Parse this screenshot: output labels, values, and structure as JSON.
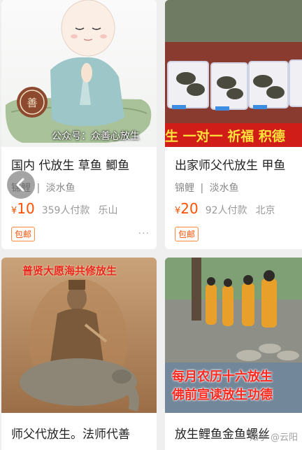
{
  "cards": [
    {
      "image_watermark": "公众号：众善心放生",
      "title": "国内 代放生 草鱼 鲫鱼",
      "tag1": "锦鲤",
      "sep": "|",
      "tag2": "淡水鱼",
      "currency": "¥",
      "price": "10",
      "sold": "359人付款",
      "location": "乐山",
      "badge": "包邮",
      "more": "···"
    },
    {
      "image_banner": "生 一对一 祈福 积德",
      "title": "出家师父代放生 甲鱼",
      "tag1": "锦鲤",
      "sep": "|",
      "tag2": "淡水鱼",
      "currency": "¥",
      "price": "20",
      "sold": "92人付款",
      "location": "北京",
      "badge": "包邮"
    },
    {
      "image_caption": "普贤大愿海共修放生",
      "title": "师父代放生。法师代善"
    },
    {
      "image_caption_line1": "每月农历十六放生",
      "image_caption_line2": "佛前宣读放生功德",
      "title": "放生鲤鱼金鱼螺丝",
      "watermark": "知乎 @云阳"
    }
  ],
  "nav": {
    "back_icon": "chevron-left-icon"
  },
  "colors": {
    "price": "#ff5000",
    "background": "#efefef",
    "banner_red": "#d8261e"
  }
}
